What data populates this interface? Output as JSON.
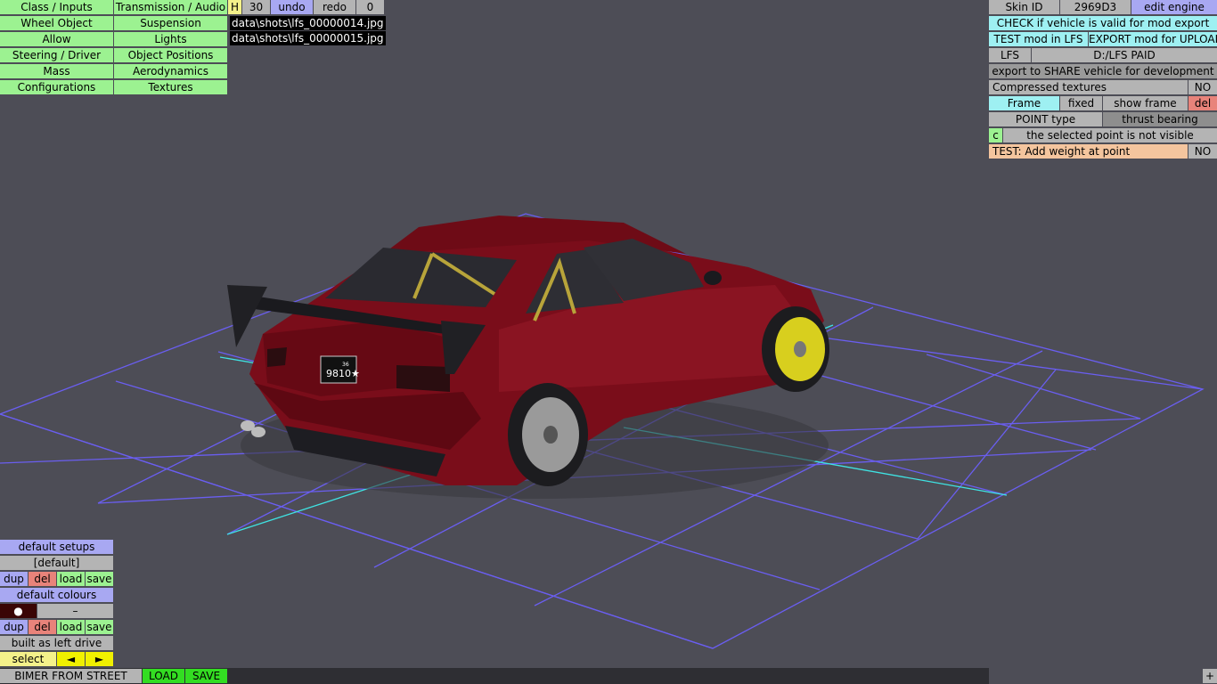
{
  "menu": {
    "class_inputs": "Class / Inputs",
    "transmission_audio": "Transmission / Audio",
    "wheel_object": "Wheel Object",
    "suspension": "Suspension",
    "allow": "Allow",
    "lights": "Lights",
    "steering_driver": "Steering / Driver",
    "object_positions": "Object Positions",
    "mass": "Mass",
    "aerodynamics": "Aerodynamics",
    "configurations": "Configurations",
    "textures": "Textures"
  },
  "toolbar": {
    "h": "H",
    "count": "30",
    "undo": "undo",
    "redo": "redo",
    "zero": "0"
  },
  "screenshots": [
    "data\\shots\\lfs_00000014.jpg",
    "data\\shots\\lfs_00000015.jpg"
  ],
  "right_panel": {
    "skin_id_label": "Skin ID",
    "skin_id_value": "2969D3",
    "edit_engine": "edit engine",
    "check_valid": "CHECK if vehicle is valid for mod export",
    "test_mod": "TEST mod in LFS",
    "export_mod": "EXPORT mod for UPLOAD",
    "lfs": "LFS",
    "lfs_path": "D:/LFS PAID",
    "export_share": "export to SHARE vehicle for development",
    "compressed_textures": "Compressed textures",
    "compressed_value": "NO",
    "frame": "Frame",
    "fixed": "fixed",
    "show_frame": "show frame",
    "del": "del",
    "point_type": "POINT type",
    "thrust_bearing": "thrust bearing",
    "c": "c",
    "point_not_visible": "the selected point is not visible",
    "test_add_weight": "TEST: Add weight at point",
    "test_add_weight_value": "NO"
  },
  "bottom_panel": {
    "default_setups": "default setups",
    "default_setup_name": "[default]",
    "dup": "dup",
    "del": "del",
    "load": "load",
    "save": "save",
    "default_colours": "default colours",
    "colour_swatch": "●",
    "colour_dash": "–",
    "built_left": "built as left drive",
    "select": "select",
    "prev": "◄",
    "next": "►"
  },
  "status_bar": {
    "vehicle_name": "BIMER FROM STREET",
    "load": "LOAD",
    "save": "SAVE",
    "plus": "+"
  },
  "vehicle": {
    "plate_text": "9810★",
    "plate_top": "36",
    "body_color": "#7a0d1a",
    "rim_front_color": "#d8cf1e",
    "rim_rear_color": "#9a9a9a"
  },
  "colors": {
    "grid_line": "#6a5ef0",
    "axis_line": "#3fe3e3",
    "background": "#4d4d56"
  }
}
